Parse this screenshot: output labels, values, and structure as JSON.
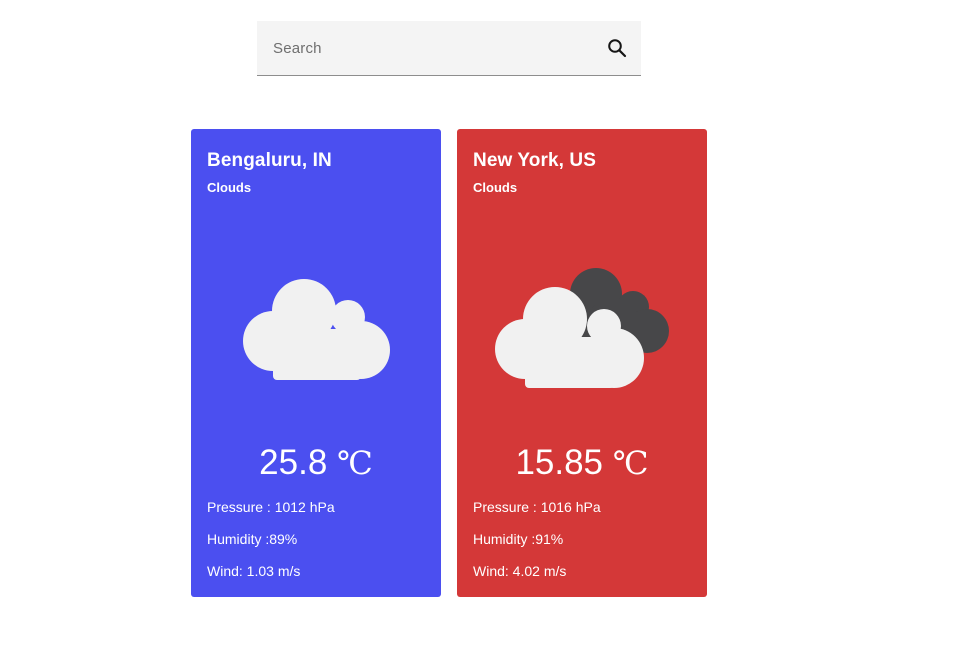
{
  "search": {
    "placeholder": "Search",
    "value": ""
  },
  "colors": {
    "card_1": "#4b4ff0",
    "card_2": "#d43838",
    "cloud_light": "#f1f1f1",
    "cloud_dark": "#474749"
  },
  "cards": [
    {
      "city": "Bengaluru, IN",
      "condition": "Clouds",
      "icon": "cloud-icon",
      "temp": "25.8",
      "unit": "℃",
      "pressure": "Pressure : 1012 hPa",
      "humidity": "Humidity :89%",
      "wind": "Wind: 1.03 m/s"
    },
    {
      "city": "New York, US",
      "condition": "Clouds",
      "icon": "broken-clouds-icon",
      "temp": "15.85",
      "unit": "℃",
      "pressure": "Pressure : 1016 hPa",
      "humidity": "Humidity :91%",
      "wind": "Wind: 4.02 m/s"
    }
  ]
}
